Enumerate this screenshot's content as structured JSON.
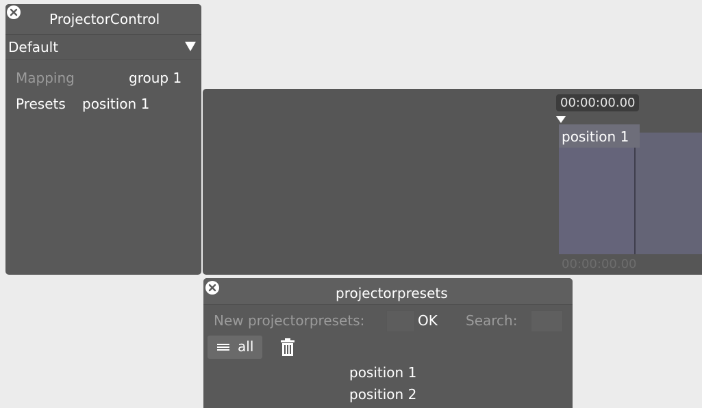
{
  "projector_control": {
    "title": "ProjectorControl",
    "dropdown_value": "Default",
    "mapping_label": "Mapping",
    "mapping_value": "group 1",
    "presets_label": "Presets",
    "presets_value": "position 1"
  },
  "timeline": {
    "time_top": "00:00:00.00",
    "clip_label": "position 1",
    "time_bottom": "00:00:00.00",
    "clip_color": "#65647a"
  },
  "projector_presets": {
    "title": "projectorpresets",
    "new_label": "New projectorpresets:",
    "new_value": "",
    "ok_label": "OK",
    "search_label": "Search:",
    "search_value": "",
    "filter_label": "all",
    "items": [
      "position 1",
      "position 2"
    ]
  },
  "icons": {
    "close": "close-icon",
    "dropdown": "triangle-down-icon",
    "list": "list-icon",
    "trash": "trash-icon",
    "playhead": "playhead-icon"
  }
}
